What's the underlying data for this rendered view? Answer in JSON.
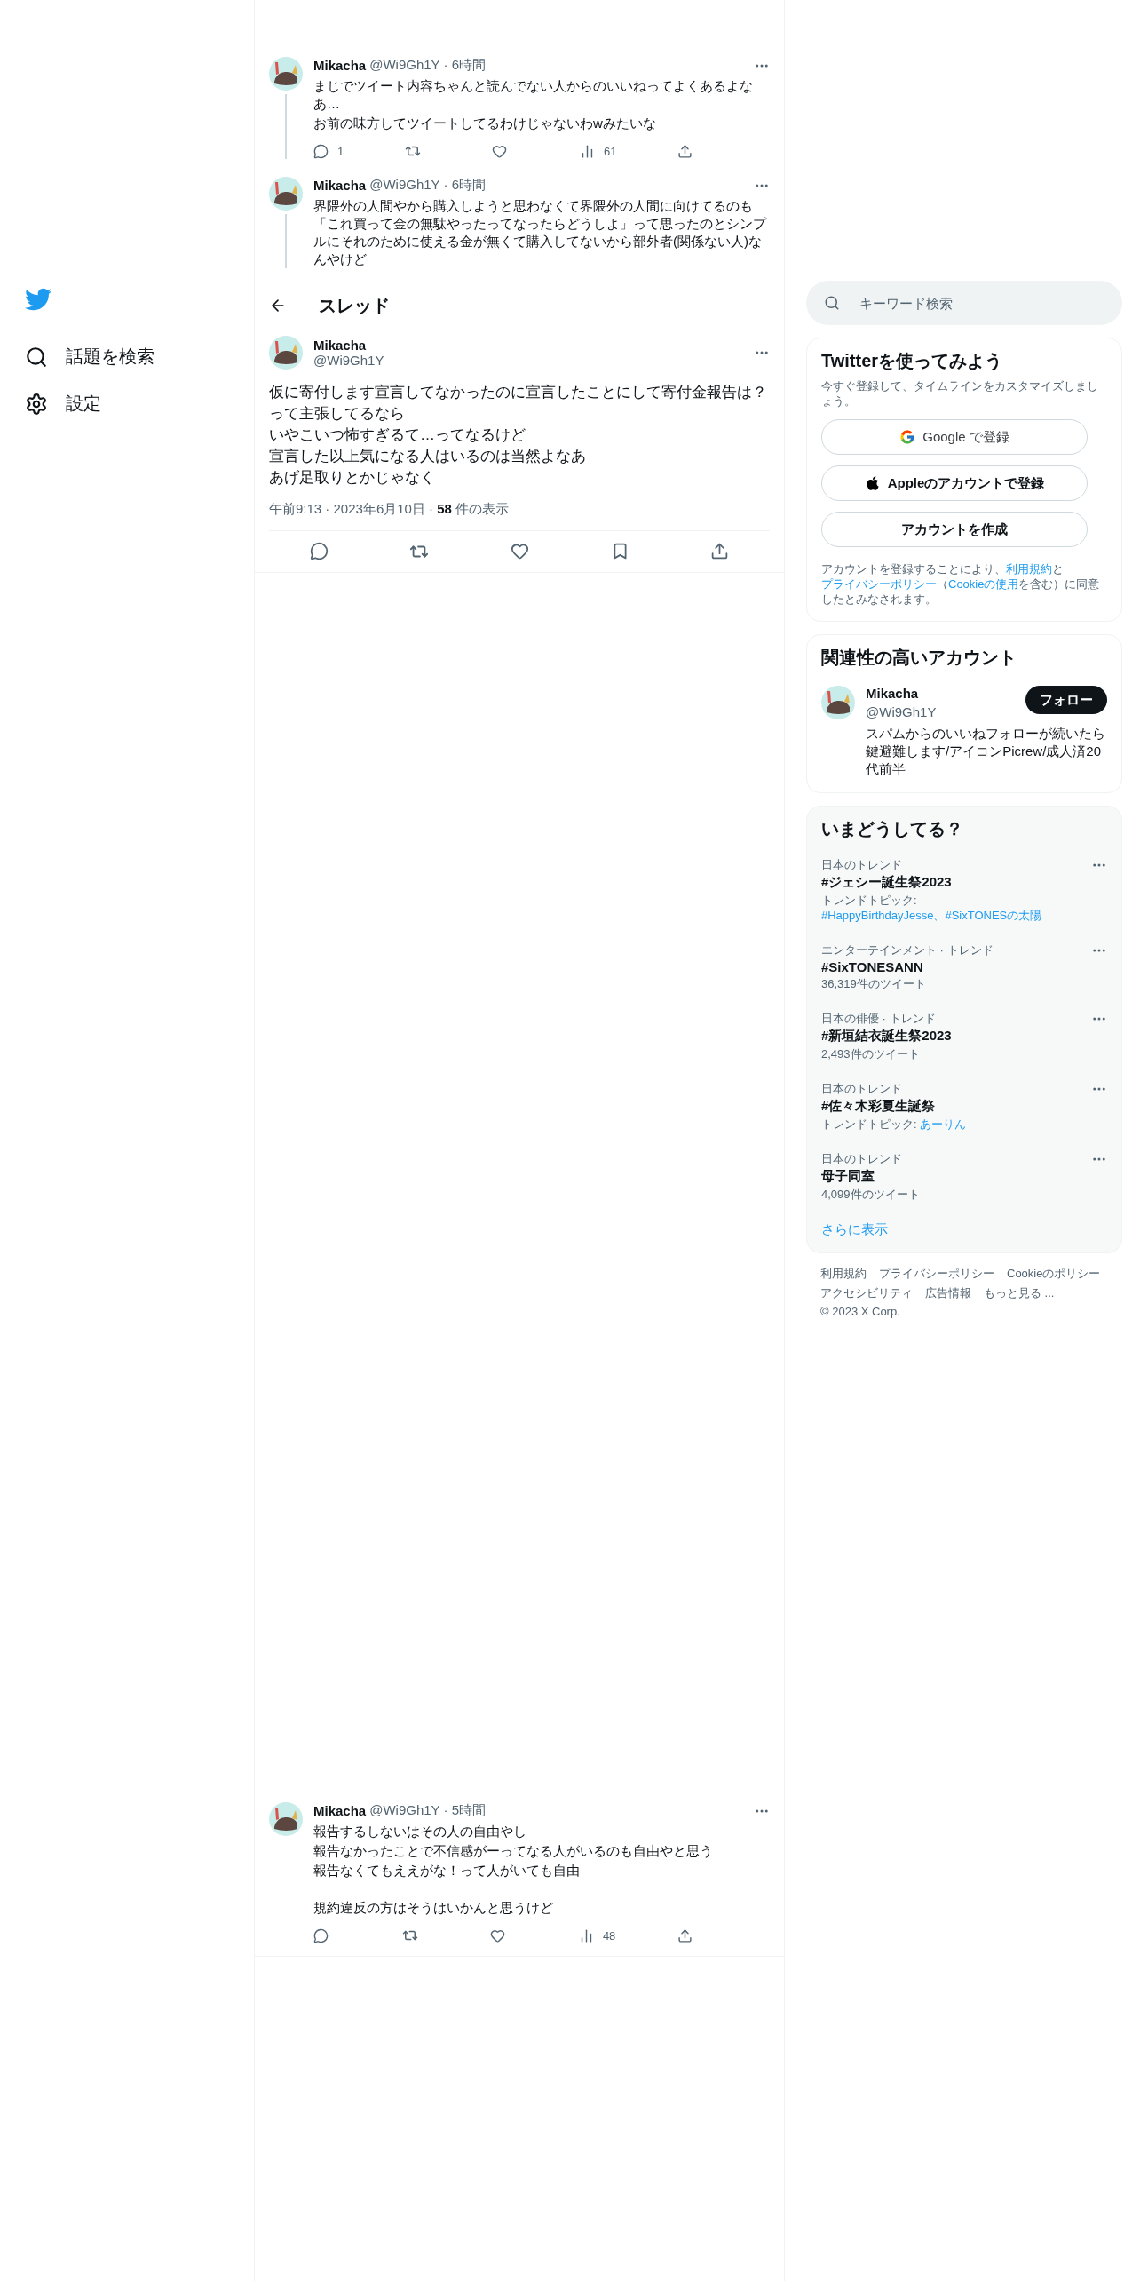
{
  "sidebar": {
    "items": [
      {
        "label": "話題を検索",
        "kind": "search"
      },
      {
        "label": "設定",
        "kind": "settings"
      }
    ]
  },
  "thread_above": [
    {
      "name": "Mikacha",
      "meta": "@Wi9Gh1Y · 6時間",
      "paragraphs": [
        [
          "まじでツイート内容ちゃんと読んでない人からのいいねってよくあるよなあ…",
          "お前の味方してツイートしてるわけじゃないわwみたいな"
        ]
      ],
      "replies": "1",
      "views": "61",
      "actions_visible": true
    },
    {
      "name": "Mikacha",
      "meta": "@Wi9Gh1Y · 6時間",
      "paragraphs": [
        [
          "界隈外の人間やから購入しようと思わなくて界隈外の人間に向けてるのも「これ買って金の無駄やったってなったらどうしよ」って思ったのとシンプルにそれのために使える金が無くて購入してないから部外者(関係ない人)なんやけど"
        ]
      ],
      "actions_visible": false
    }
  ],
  "header": {
    "title": "スレッド"
  },
  "main_tweet": {
    "name": "Mikacha",
    "handle": "@Wi9Gh1Y",
    "lines": [
      "仮に寄付します宣言してなかったのに宣言したことにして寄付金報告は？って主張してるなら",
      "いやこいつ怖すぎるて…ってなるけど",
      "宣言した以上気になる人はいるのは当然よなあ",
      "あげ足取りとかじゃなく"
    ],
    "meta": "午前9:13 · 2023年6月10日 · **58** 件の表示"
  },
  "replies": [
    {
      "name": "Mikacha",
      "meta": "@Wi9Gh1Y · 5時間",
      "paragraphs": [
        [
          "報告するしないはその人の自由やし",
          "報告なかったことで不信感がーってなる人がいるのも自由やと思う",
          "報告なくてもええがな！って人がいても自由"
        ],
        [
          "規約違反の方はそうはいかんと思うけど"
        ]
      ],
      "views": "48",
      "actions_visible": true
    }
  ],
  "search": {
    "placeholder": "キーワード検索"
  },
  "signup": {
    "title": "Twitterを使ってみよう",
    "subtitle": "今すぐ登録して、タイムラインをカスタマイズしましょう。",
    "buttons": [
      {
        "label": "Google で登録",
        "kind": "google"
      },
      {
        "label": "Appleのアカウントで登録",
        "kind": "apple"
      },
      {
        "label": "アカウントを作成",
        "kind": "plain"
      }
    ],
    "legal": [
      {
        "text": "アカウントを登録することにより、",
        "link": false
      },
      {
        "text": "利用規約",
        "link": true
      },
      {
        "text": "と",
        "link": false
      },
      {
        "text": "プライバシーポリシー",
        "link": true
      },
      {
        "text": "（",
        "link": false
      },
      {
        "text": "Cookieの使用",
        "link": true
      },
      {
        "text": "を含む）に同意したとみなされます。",
        "link": false
      }
    ]
  },
  "related": {
    "title": "関連性の高いアカウント",
    "account": {
      "name": "Mikacha",
      "handle": "@Wi9Gh1Y",
      "bio": "スパムからのいいねフォローが続いたら鍵避難します/アイコンPicrew/成人済20代前半",
      "button": "フォロー"
    }
  },
  "trends": {
    "title": "いまどうしてる？",
    "items": [
      {
        "category": "日本のトレンド",
        "title": "#ジェシー誕生祭2023",
        "topic_label": "トレンドトピック:",
        "topics": "#HappyBirthdayJesse、#SixTONESの太陽"
      },
      {
        "category": "エンターテインメント · トレンド",
        "title": "#SixTONESANN",
        "count": "36,319件のツイート"
      },
      {
        "category": "日本の俳優 · トレンド",
        "title": "#新垣結衣誕生祭2023",
        "count": "2,493件のツイート"
      },
      {
        "category": "日本のトレンド",
        "title": "#佐々木彩夏生誕祭",
        "topic_label": "トレンドトピック:",
        "topics": "あーりん"
      },
      {
        "category": "日本のトレンド",
        "title": "母子同室",
        "count": "4,099件のツイート"
      }
    ],
    "more": "さらに表示"
  },
  "footer": {
    "links": [
      "利用規約",
      "プライバシーポリシー",
      "Cookieのポリシー",
      "アクセシビリティ",
      "広告情報",
      "もっと見る ..."
    ],
    "copyright": "© 2023 X Corp."
  }
}
